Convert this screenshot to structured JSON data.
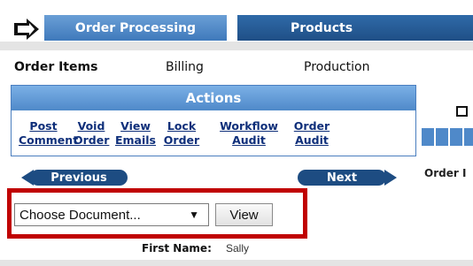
{
  "header": {
    "tabs": [
      {
        "label": "Order Processing"
      },
      {
        "label": "Products"
      }
    ],
    "logo_icon": "arrow-right-icon"
  },
  "subnav": {
    "items": [
      "Order Items",
      "Billing",
      "Production"
    ]
  },
  "actions": {
    "title": "Actions",
    "links": [
      {
        "line1": "Post",
        "line2": "Comment"
      },
      {
        "line1": "Void",
        "line2": "Order"
      },
      {
        "line1": "View",
        "line2": "Emails"
      },
      {
        "line1": "Lock",
        "line2": "Order"
      },
      {
        "line1": "Workflow",
        "line2": "Audit"
      },
      {
        "line1": "Order",
        "line2": "Audit"
      }
    ]
  },
  "side": {
    "label": "Order I",
    "icon": "checkbox-icon"
  },
  "pager": {
    "previous": "Previous",
    "next": "Next"
  },
  "document": {
    "select_value": "Choose Document...",
    "view_label": "View"
  },
  "customer": {
    "first_name_label": "First Name:",
    "first_name_value": "Sally"
  },
  "colors": {
    "highlight": "#c00000",
    "tab_light": "#4f89c9",
    "tab_dark": "#1f4f86",
    "link": "#0f2f7a"
  }
}
